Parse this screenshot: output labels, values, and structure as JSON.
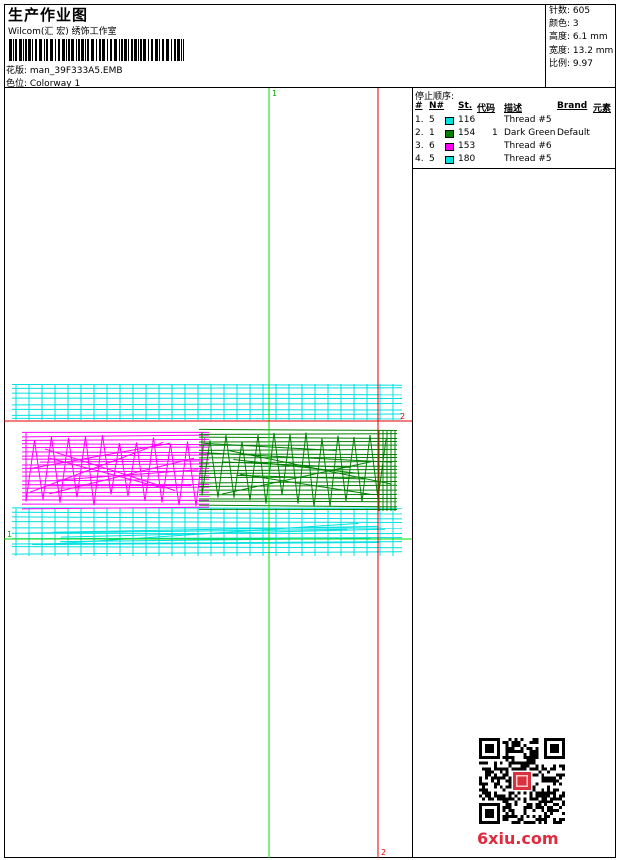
{
  "header": {
    "title": "生产作业图",
    "studio": "Wilcom(汇 宏) 绣饰工作室",
    "pattern_line": "花版: man_39F333A5.EMB",
    "color_line": "色位: Colorway 1"
  },
  "stats": [
    "针数: 605",
    "颜色: 3",
    "高度: 6.1 mm",
    "宽度: 13.2 mm",
    "比例: 9.97"
  ],
  "stop_sequence": {
    "title": "停止顺序:",
    "headers": {
      "order": "#",
      "no": "N#",
      "st": "St.",
      "code": "代码",
      "desc": "描述",
      "brand": "Brand",
      "element": "元素"
    },
    "rows": [
      {
        "order": "1.",
        "no": "5",
        "color": "#00e0e0",
        "st": "116",
        "code": "",
        "desc": "Thread #5",
        "brand": ""
      },
      {
        "order": "2.",
        "no": "1",
        "color": "#008000",
        "st": "154",
        "code": "1",
        "desc": "Dark Green",
        "brand": "Default"
      },
      {
        "order": "3.",
        "no": "6",
        "color": "#ff00ff",
        "st": "153",
        "code": "",
        "desc": "Thread #6",
        "brand": ""
      },
      {
        "order": "4.",
        "no": "5",
        "color": "#00e0e0",
        "st": "180",
        "code": "",
        "desc": "Thread #5",
        "brand": ""
      }
    ]
  },
  "guides": {
    "green_top_label": "1",
    "green_left_label": "1",
    "red_right_label": "2",
    "red_bottom_label": "2"
  },
  "watermark": {
    "site": "6xiu.com"
  },
  "colors": {
    "cyan": "#00e0e0",
    "green": "#008000",
    "magenta": "#ff00ff",
    "guide_green": "#00dd00",
    "guide_red": "#e00000"
  }
}
